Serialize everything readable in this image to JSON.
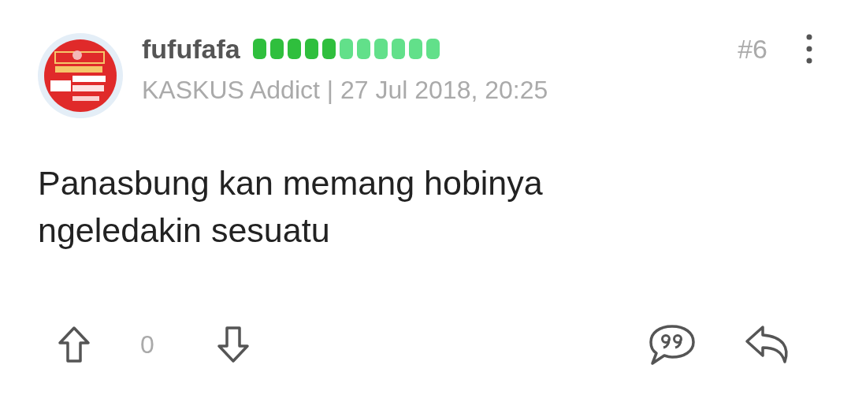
{
  "post": {
    "username": "fufufafa",
    "reputation_pips": [
      {
        "filled": true
      },
      {
        "filled": true
      },
      {
        "filled": true
      },
      {
        "filled": true
      },
      {
        "filled": true
      },
      {
        "filled": false
      },
      {
        "filled": false
      },
      {
        "filled": false
      },
      {
        "filled": false
      },
      {
        "filled": false
      },
      {
        "filled": false
      }
    ],
    "rank": "KASKUS Addict",
    "separator": "|",
    "timestamp": "27 Jul 2018, 20:25",
    "post_number": "#6",
    "body": "Panasbung kan memang hobinya ngeledakin sesuatu",
    "vote_count": "0"
  }
}
